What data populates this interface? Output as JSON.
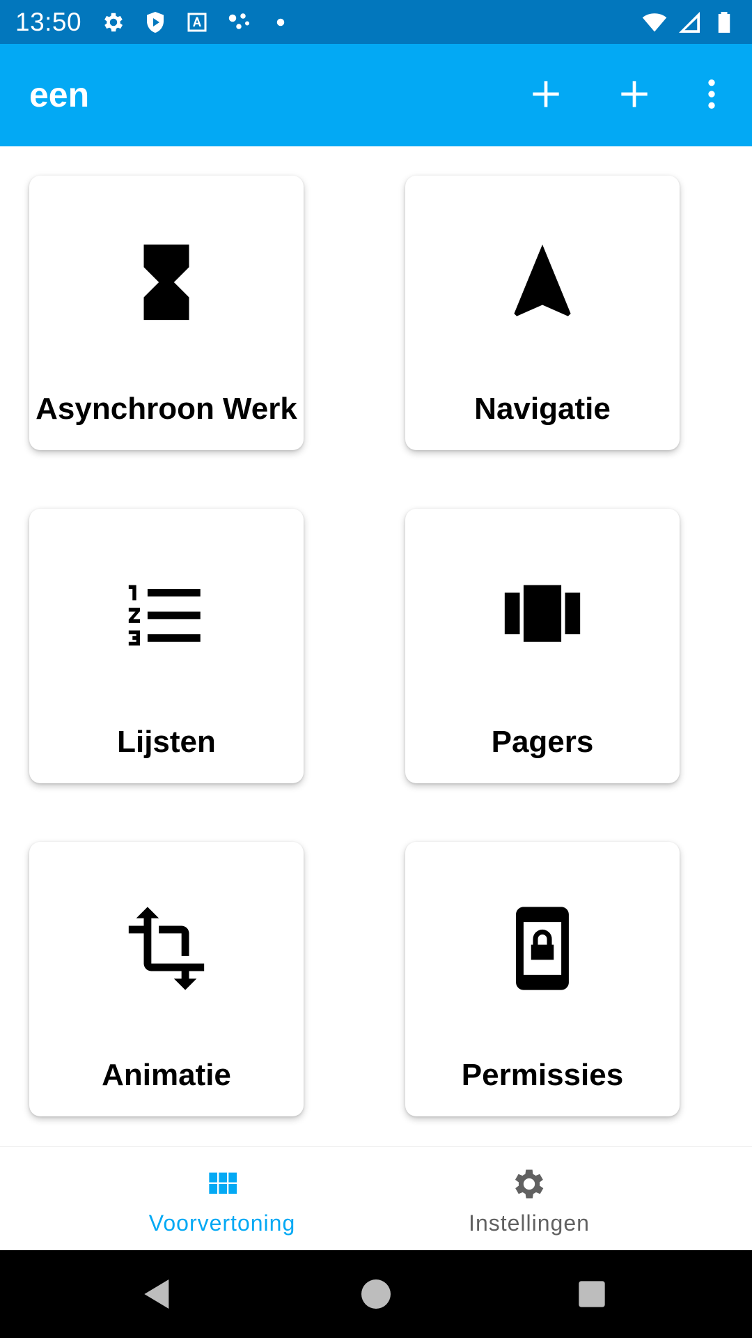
{
  "status_bar": {
    "time": "13:50",
    "left_icons": [
      "settings-icon",
      "shield-play-icon",
      "text-a-icon",
      "dots-network-icon",
      "dot-icon"
    ],
    "right_icons": [
      "wifi-icon",
      "cell-signal-icon",
      "battery-icon"
    ]
  },
  "app_bar": {
    "title": "een",
    "actions": [
      "add-icon",
      "add-icon",
      "more-vert-icon"
    ],
    "color": "#03a9f4"
  },
  "cards": [
    {
      "label": "Asynchroon Werk",
      "icon": "hourglass-icon"
    },
    {
      "label": "Navigatie",
      "icon": "navigation-arrow-icon"
    },
    {
      "label": "Lijsten",
      "icon": "numbered-list-icon"
    },
    {
      "label": "Pagers",
      "icon": "view-carousel-icon"
    },
    {
      "label": "Animatie",
      "icon": "transform-icon"
    },
    {
      "label": "Permissies",
      "icon": "phone-lock-icon"
    }
  ],
  "bottom_nav": {
    "items": [
      {
        "label": "Voorvertoning",
        "icon": "grid-icon",
        "active": true
      },
      {
        "label": "Instellingen",
        "icon": "gear-icon",
        "active": false
      }
    ],
    "active_color": "#03a9f4",
    "inactive_color": "#616161"
  },
  "system_nav": [
    "back-icon",
    "home-icon",
    "recents-icon"
  ]
}
